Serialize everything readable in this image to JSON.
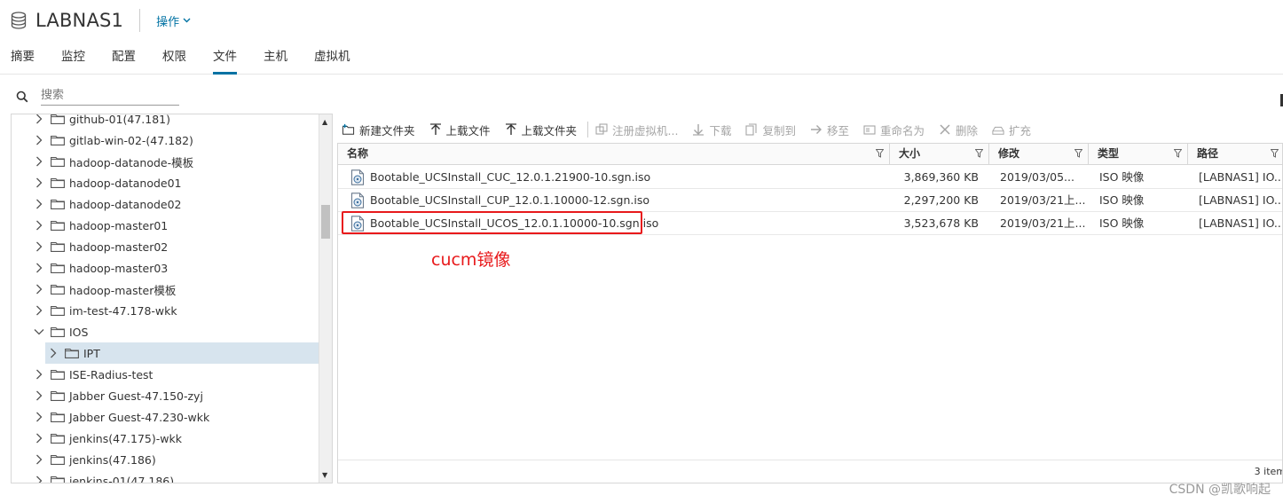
{
  "header": {
    "title": "LABNAS1",
    "actions_label": "操作",
    "tabs": [
      {
        "label": "摘要"
      },
      {
        "label": "监控"
      },
      {
        "label": "配置"
      },
      {
        "label": "权限"
      },
      {
        "label": "文件",
        "active": true
      },
      {
        "label": "主机"
      },
      {
        "label": "虚拟机"
      }
    ]
  },
  "search": {
    "placeholder": "搜索"
  },
  "tree": {
    "items": [
      {
        "label": "github-01(47.181)",
        "expanded": false,
        "level": 0
      },
      {
        "label": "gitlab-win-02-(47.182)",
        "expanded": false,
        "level": 0
      },
      {
        "label": "hadoop-datanode-模板",
        "expanded": false,
        "level": 0
      },
      {
        "label": "hadoop-datanode01",
        "expanded": false,
        "level": 0
      },
      {
        "label": "hadoop-datanode02",
        "expanded": false,
        "level": 0
      },
      {
        "label": "hadoop-master01",
        "expanded": false,
        "level": 0
      },
      {
        "label": "hadoop-master02",
        "expanded": false,
        "level": 0
      },
      {
        "label": "hadoop-master03",
        "expanded": false,
        "level": 0
      },
      {
        "label": "hadoop-master模板",
        "expanded": false,
        "level": 0
      },
      {
        "label": "im-test-47.178-wkk",
        "expanded": false,
        "level": 0
      },
      {
        "label": "IOS",
        "expanded": true,
        "level": 0
      },
      {
        "label": "IPT",
        "expanded": false,
        "level": 1,
        "selected": true
      },
      {
        "label": "ISE-Radius-test",
        "expanded": false,
        "level": 0
      },
      {
        "label": "Jabber Guest-47.150-zyj",
        "expanded": false,
        "level": 0
      },
      {
        "label": "Jabber Guest-47.230-wkk",
        "expanded": false,
        "level": 0
      },
      {
        "label": "jenkins(47.175)-wkk",
        "expanded": false,
        "level": 0
      },
      {
        "label": "jenkins(47.186)",
        "expanded": false,
        "level": 0
      },
      {
        "label": "jenkins-01(47.186)",
        "expanded": false,
        "level": 0
      }
    ]
  },
  "toolbar": {
    "buttons": [
      {
        "label": "新建文件夹",
        "icon": "new-folder-icon",
        "enabled": true
      },
      {
        "label": "上载文件",
        "icon": "upload-icon",
        "enabled": true
      },
      {
        "label": "上载文件夹",
        "icon": "upload-icon",
        "enabled": true
      },
      {
        "label": "注册虚拟机...",
        "icon": "register-vm-icon",
        "enabled": false
      },
      {
        "label": "下载",
        "icon": "download-icon",
        "enabled": false
      },
      {
        "label": "复制到",
        "icon": "copy-icon",
        "enabled": false
      },
      {
        "label": "移至",
        "icon": "move-icon",
        "enabled": false
      },
      {
        "label": "重命名为",
        "icon": "rename-icon",
        "enabled": false
      },
      {
        "label": "删除",
        "icon": "delete-icon",
        "enabled": false
      },
      {
        "label": "扩充",
        "icon": "inflate-icon",
        "enabled": false
      }
    ]
  },
  "grid": {
    "columns": [
      "名称",
      "大小",
      "修改",
      "类型",
      "路径"
    ],
    "rows": [
      {
        "name": "Bootable_UCSInstall_CUC_12.0.1.21900-10.sgn.iso",
        "size": "3,869,360 KB",
        "modified": "2019/03/05...",
        "type": "ISO 映像",
        "path": "[LABNAS1] IO..."
      },
      {
        "name": "Bootable_UCSInstall_CUP_12.0.1.10000-12.sgn.iso",
        "size": "2,297,200 KB",
        "modified": "2019/03/21上...",
        "type": "ISO 映像",
        "path": "[LABNAS1] IO..."
      },
      {
        "name": "Bootable_UCSInstall_UCOS_12.0.1.10000-10.sgn.iso",
        "size": "3,523,678 KB",
        "modified": "2019/03/21上...",
        "type": "ISO 映像",
        "path": "[LABNAS1] IO..."
      }
    ],
    "item_count": "3 item"
  },
  "annotation": {
    "text": "cucm镜像",
    "color": "#e8191b"
  },
  "watermark": "CSDN @凯歌响起",
  "colors": {
    "accent": "#0072a3",
    "selected_row": "#d7e4ee",
    "annotation_red": "#e8191b"
  }
}
